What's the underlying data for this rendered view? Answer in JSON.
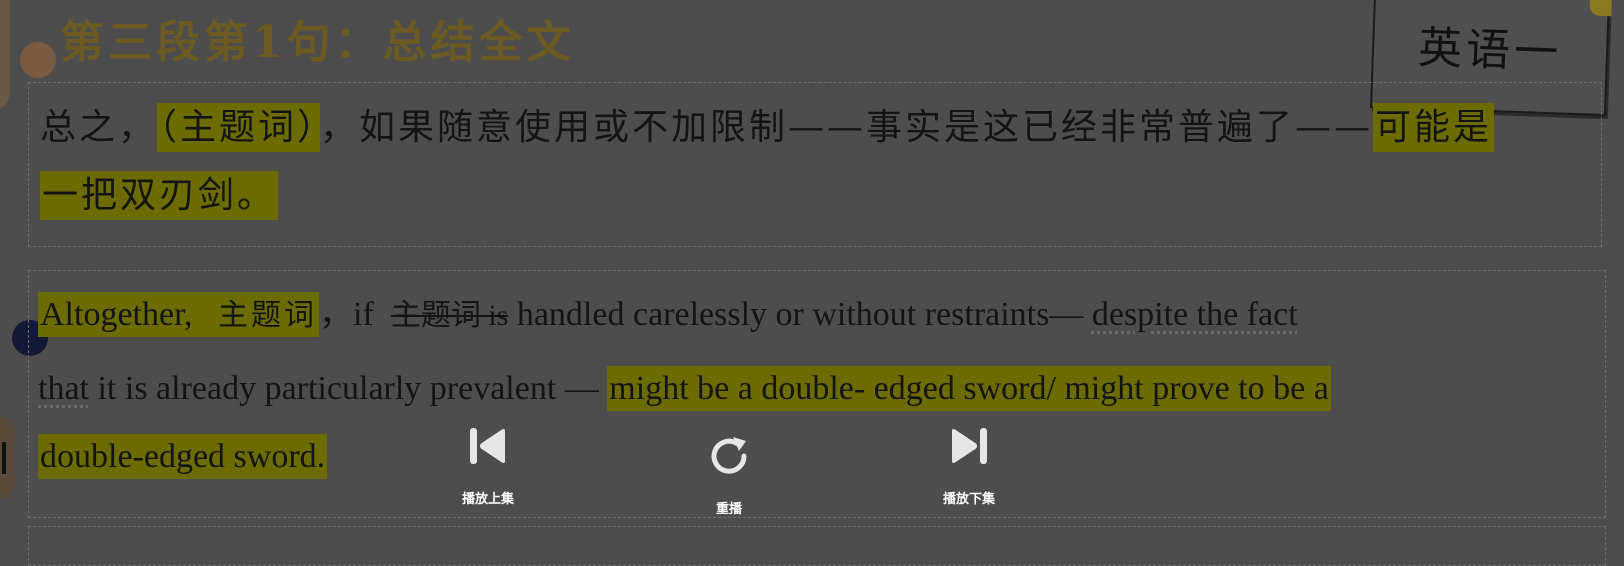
{
  "section_title": "第三段第1句：总结全文",
  "tag": "英语一",
  "chinese": {
    "line1": {
      "before": "总之，",
      "highlight1": "（主题词）",
      "middle": "，如果随意使用或不加限制——事实是这已经非常普遍了——",
      "highlight2": "可能是"
    },
    "line2": {
      "highlight": "一把双刃剑。"
    }
  },
  "english": {
    "line1": {
      "hl_word": "Altogether,",
      "hl_topic": "主题词",
      "sep": "，if",
      "strike": "主题词 is",
      "plain": "handled carelessly or without restraints—",
      "dotted": "despite the fact"
    },
    "line2": {
      "dotted": "that",
      "plain": "it is already particularly prevalent —",
      "highlight": "might be a double- edged sword/ might prove to be a"
    },
    "line3": {
      "highlight": "double-edged sword."
    }
  },
  "controls": {
    "prev_label": "播放上集",
    "replay_label": "重播",
    "next_label": "播放下集"
  },
  "colors": {
    "overlay_bg": "#4d4d4d",
    "highlight": "#6b6b00",
    "title": "#6b5a22"
  }
}
